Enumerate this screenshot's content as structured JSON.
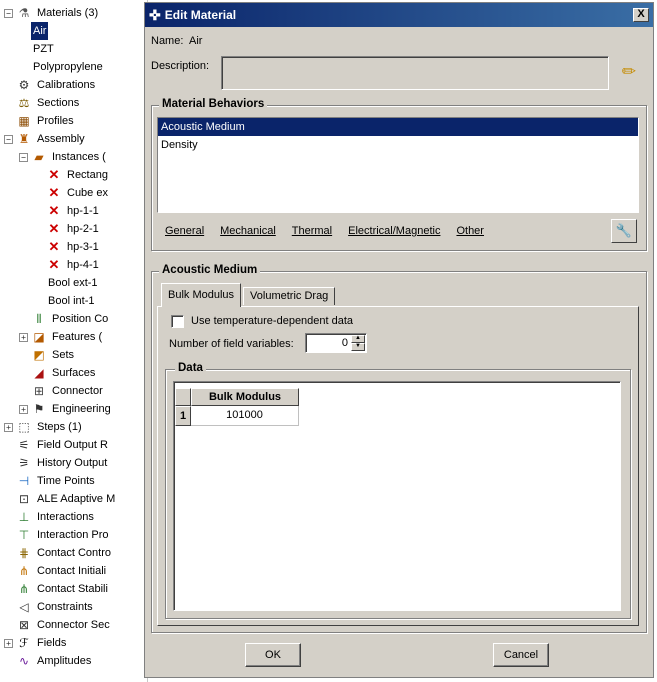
{
  "tree": {
    "items": [
      {
        "label": "Materials (3)",
        "icon": "materials-icon",
        "expander": "−"
      },
      {
        "label": "Air",
        "selected": true
      },
      {
        "label": "PZT"
      },
      {
        "label": "Polypropylene"
      },
      {
        "label": "Calibrations",
        "icon": "calibrations-icon"
      },
      {
        "label": "Sections",
        "icon": "sections-icon"
      },
      {
        "label": "Profiles",
        "icon": "profiles-icon"
      },
      {
        "label": "Assembly",
        "icon": "assembly-icon",
        "expander": "−"
      },
      {
        "label": "Instances (",
        "icon": "instances-icon",
        "expander": "−"
      },
      {
        "label": "Rectang",
        "icon": "x-mark-icon"
      },
      {
        "label": "Cube ex",
        "icon": "x-mark-icon"
      },
      {
        "label": "hp-1-1",
        "icon": "x-mark-icon"
      },
      {
        "label": "hp-2-1",
        "icon": "x-mark-icon"
      },
      {
        "label": "hp-3-1",
        "icon": "x-mark-icon"
      },
      {
        "label": "hp-4-1",
        "icon": "x-mark-icon"
      },
      {
        "label": "Bool ext-1"
      },
      {
        "label": "Bool int-1"
      },
      {
        "label": "Position Co",
        "icon": "position-constraints-icon"
      },
      {
        "label": "Features (",
        "icon": "features-icon",
        "expander": "+"
      },
      {
        "label": "Sets",
        "icon": "sets-icon"
      },
      {
        "label": "Surfaces",
        "icon": "surfaces-icon"
      },
      {
        "label": "Connector",
        "icon": "connector-icon"
      },
      {
        "label": "Engineering",
        "icon": "engineering-icon",
        "expander": "+"
      },
      {
        "label": "Steps (1)",
        "icon": "steps-icon",
        "expander": "+"
      },
      {
        "label": "Field Output R",
        "icon": "field-output-icon"
      },
      {
        "label": "History Output",
        "icon": "history-output-icon"
      },
      {
        "label": "Time Points",
        "icon": "time-points-icon"
      },
      {
        "label": "ALE Adaptive M",
        "icon": "ale-adaptive-icon"
      },
      {
        "label": "Interactions",
        "icon": "interactions-icon"
      },
      {
        "label": "Interaction Pro",
        "icon": "interaction-properties-icon"
      },
      {
        "label": "Contact Contro",
        "icon": "contact-controls-icon"
      },
      {
        "label": "Contact Initiali",
        "icon": "contact-initialization-icon"
      },
      {
        "label": "Contact Stabili",
        "icon": "contact-stabilization-icon"
      },
      {
        "label": "Constraints",
        "icon": "constraints-icon"
      },
      {
        "label": "Connector Sec",
        "icon": "connector-sections-icon"
      },
      {
        "label": "Fields",
        "icon": "fields-icon",
        "expander": "+"
      },
      {
        "label": "Amplitudes",
        "icon": "amplitudes-icon"
      }
    ]
  },
  "dialog": {
    "title": "Edit Material",
    "close_label": "X",
    "name_label": "Name:",
    "name_value": "Air",
    "description_label": "Description:",
    "description_value": "",
    "behaviors": {
      "title": "Material Behaviors",
      "items": [
        "Acoustic Medium",
        "Density"
      ],
      "selected_index": 0,
      "menus": [
        "General",
        "Mechanical",
        "Thermal",
        "Electrical/Magnetic",
        "Other"
      ]
    },
    "acoustic": {
      "title": "Acoustic Medium",
      "tabs": [
        "Bulk Modulus",
        "Volumetric Drag"
      ],
      "active_tab": 0,
      "temp_checkbox_label": "Use temperature-dependent data",
      "temp_checkbox_checked": false,
      "field_vars_label": "Number of field variables:",
      "field_vars_value": "0",
      "data_title": "Data",
      "table": {
        "columns": [
          "Bulk Modulus"
        ],
        "rows": [
          {
            "index": "1",
            "values": [
              "101000"
            ]
          }
        ]
      }
    },
    "ok_label": "OK",
    "cancel_label": "Cancel"
  },
  "colors": {
    "dialog_bg": "#d4d0c8",
    "selection": "#0a246a",
    "titlebar": "#0a246a"
  }
}
